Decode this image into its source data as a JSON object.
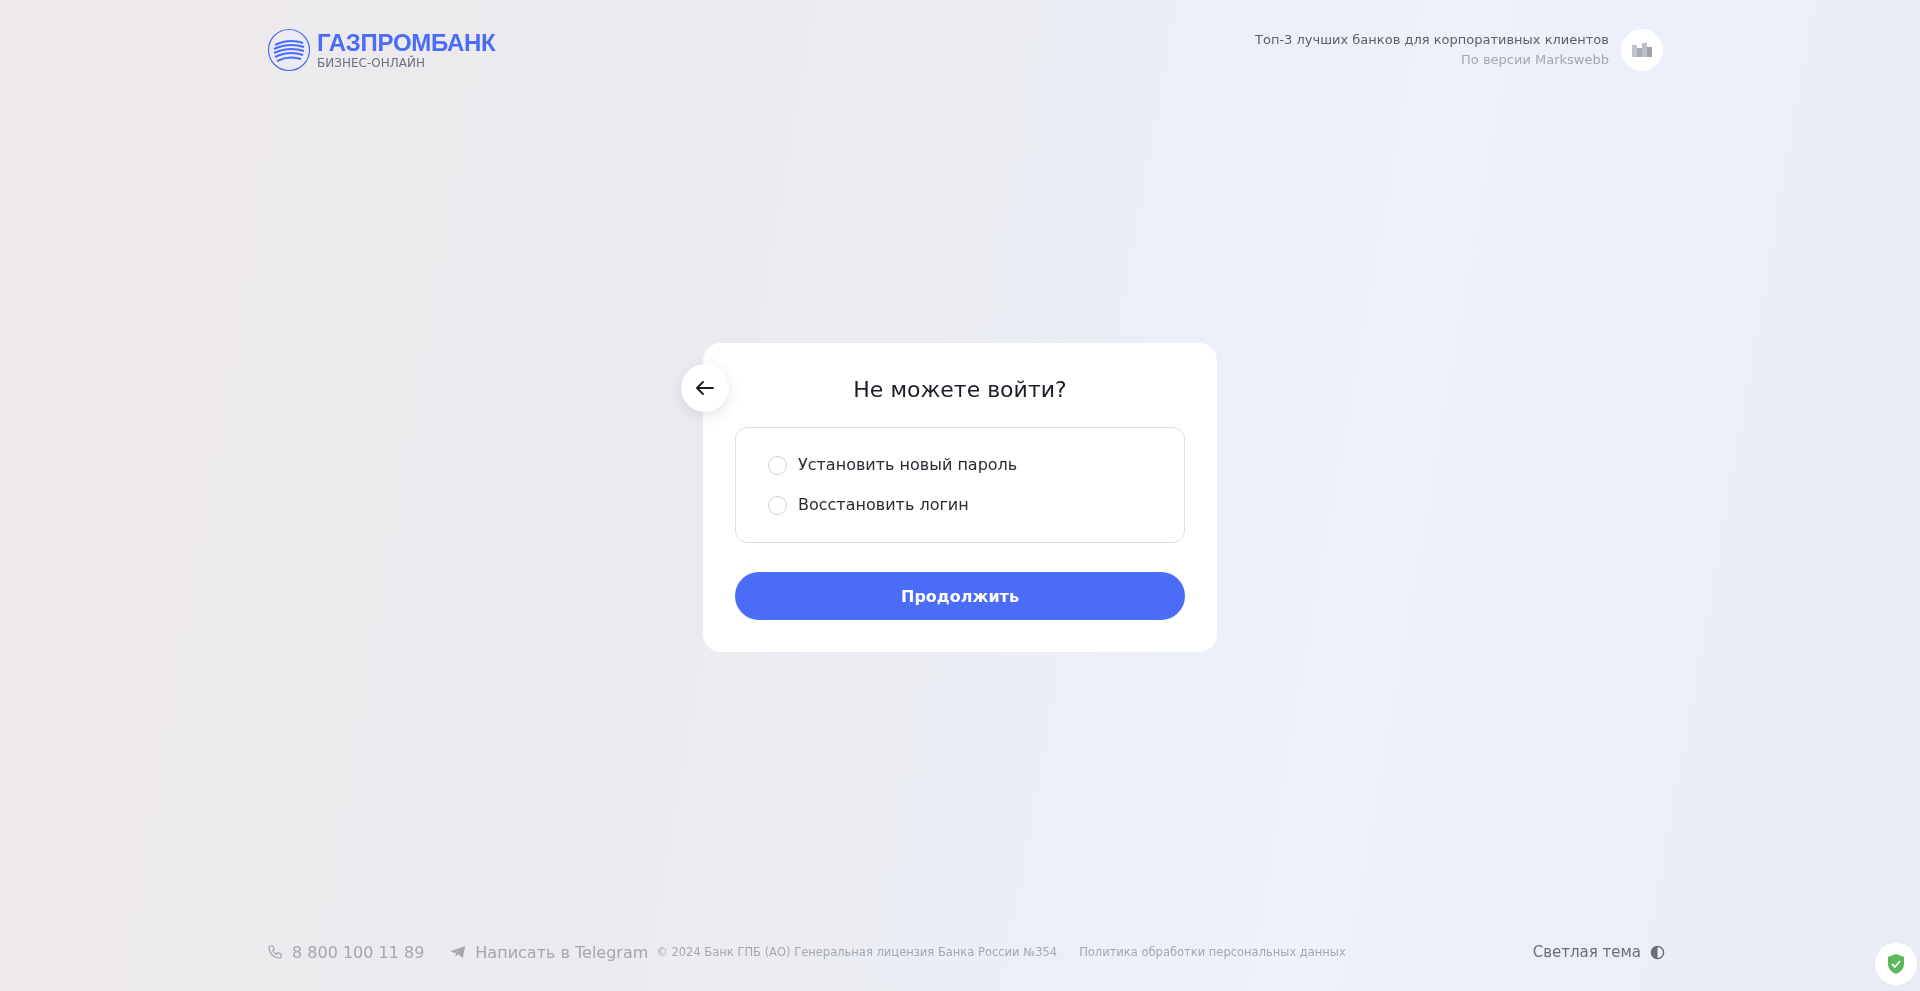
{
  "header": {
    "brand": "ГАЗПРОМБАНК",
    "subtitle": "БИЗНЕС-ОНЛАЙН",
    "award": "Топ-3 лучших банков для корпоративных клиентов",
    "award_source": "По версии Markswebb"
  },
  "dialog": {
    "title": "Не можете войти?",
    "options": [
      {
        "label": "Установить новый пароль",
        "selected": false
      },
      {
        "label": "Восстановить логин",
        "selected": false
      }
    ],
    "button": "Продолжить"
  },
  "footer": {
    "phone": "8 800 100 11 89",
    "telegram": "Написать в Telegram",
    "copyright": "© 2024 Банк ГПБ (АО) Генеральная лицензия Банка России №354",
    "policy": "Политика обработки персональных данных",
    "theme": "Светлая тема"
  }
}
